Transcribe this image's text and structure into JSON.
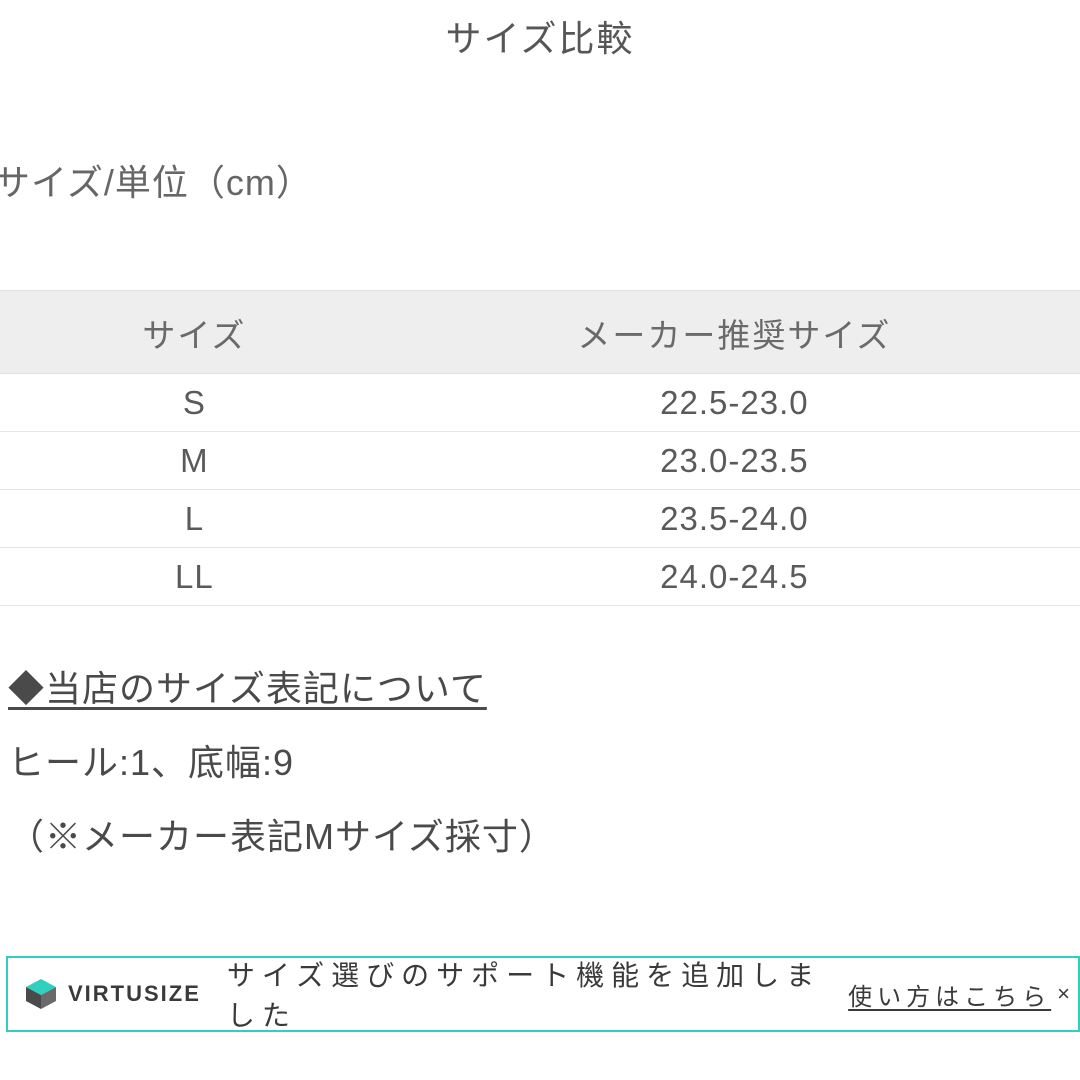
{
  "title": "サイズ比較",
  "unit_label": "サイズ/単位（cm）",
  "table": {
    "headers": [
      "サイズ",
      "メーカー推奨サイズ"
    ],
    "rows": [
      [
        "S",
        "22.5-23.0"
      ],
      [
        "M",
        "23.0-23.5"
      ],
      [
        "L",
        "23.5-24.0"
      ],
      [
        "LL",
        "24.0-24.5"
      ]
    ]
  },
  "notation": {
    "heading": "◆当店のサイズ表記について",
    "line": "ヒール:1、底幅:9",
    "note": "（※メーカー表記Mサイズ採寸）"
  },
  "banner": {
    "brand": "VIRTUSIZE",
    "text": "サイズ選びのサポート機能を追加しました",
    "link": "使い方はこちら",
    "close": "×"
  }
}
